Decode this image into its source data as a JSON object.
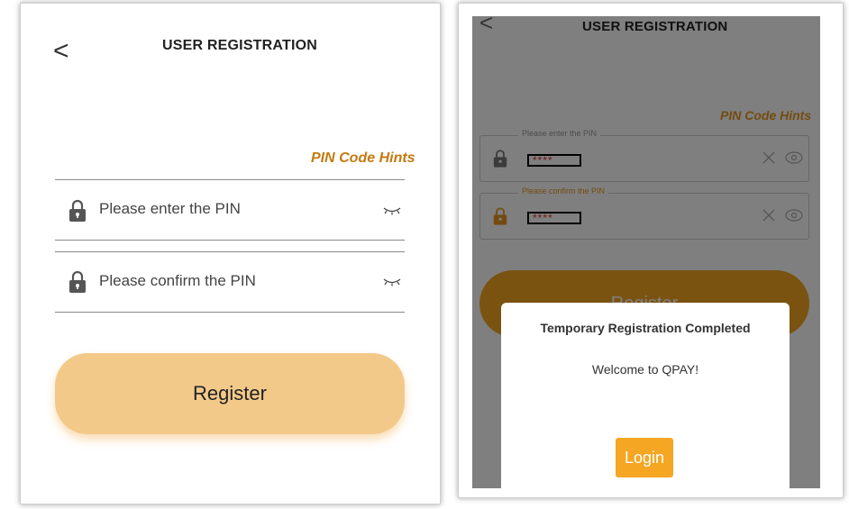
{
  "left": {
    "header": {
      "back_glyph": "<",
      "title": "USER REGISTRATION"
    },
    "hints_label": "PIN Code Hints",
    "pin_field": {
      "placeholder": "Please enter the PIN"
    },
    "confirm_field": {
      "placeholder": "Please confirm the PIN"
    },
    "register_label": "Register"
  },
  "right": {
    "header": {
      "back_glyph": "<",
      "title": "USER REGISTRATION"
    },
    "hints_label": "PIN Code Hints",
    "pin_field": {
      "legend": "Please enter the PIN",
      "masked_value": "****"
    },
    "confirm_field": {
      "legend": "Please confirm the PIN",
      "masked_value": "****"
    },
    "register_label": "Register",
    "dialog": {
      "title": "Temporary Registration Completed",
      "message": "Welcome to QPAY!",
      "login_label": "Login"
    }
  },
  "colors": {
    "accent": "#f5a623",
    "accent_light": "#f3c98a",
    "hint_text": "#c47a10",
    "mask_text": "#e03030"
  },
  "icons": [
    "back-icon",
    "lock-icon",
    "eye-closed-icon",
    "clear-x-icon",
    "eye-icon"
  ]
}
